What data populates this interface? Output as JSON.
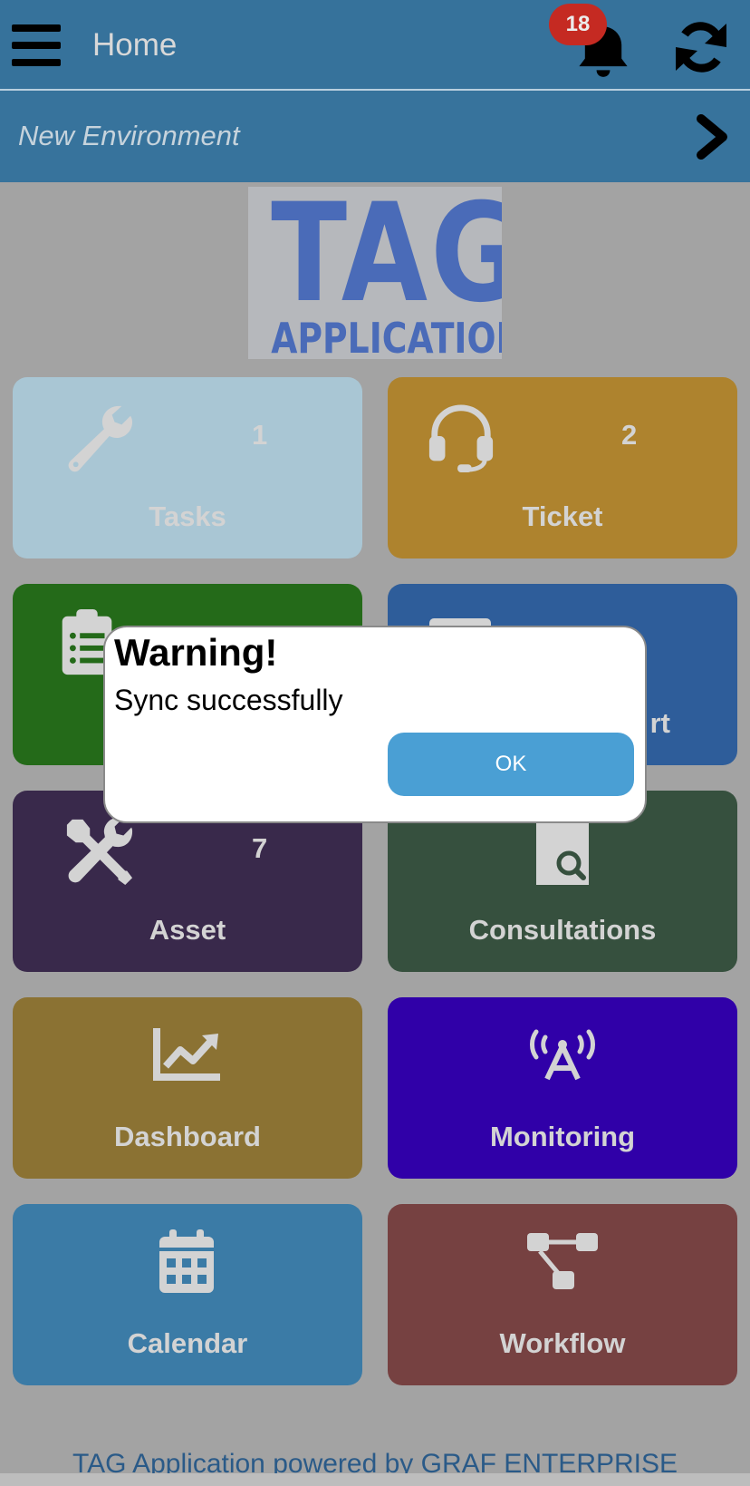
{
  "header": {
    "title": "Home",
    "notification_count": "18",
    "menu_icon": "hamburger-menu-icon",
    "bell_icon": "bell-icon",
    "sync_icon": "sync-icon"
  },
  "environment": {
    "label": "New Environment",
    "chevron_icon": "chevron-right-icon"
  },
  "logo": {
    "line1": "TAG",
    "line2": "APPLICATION"
  },
  "tiles": [
    {
      "label": "Tasks",
      "count": "1",
      "icon": "wrench-icon",
      "color": "#a9c6d4"
    },
    {
      "label": "Ticket",
      "count": "2",
      "icon": "headset-icon",
      "color": "#ae832e"
    },
    {
      "label": "",
      "count": "",
      "icon": "clipboard-list-icon",
      "color": "#246a19"
    },
    {
      "label": "rt",
      "count": "",
      "icon": "document-icon",
      "color": "#2e5d9a"
    },
    {
      "label": "Asset",
      "count": "7",
      "icon": "tools-icon",
      "color": "#39294b"
    },
    {
      "label": "Consultations",
      "count": "",
      "icon": "file-search-icon",
      "color": "#36503e"
    },
    {
      "label": "Dashboard",
      "count": "",
      "icon": "chart-line-icon",
      "color": "#8b7233"
    },
    {
      "label": "Monitoring",
      "count": "",
      "icon": "broadcast-tower-icon",
      "color": "#3000a8"
    },
    {
      "label": "Calendar",
      "count": "",
      "icon": "calendar-icon",
      "color": "#3b7ba6"
    },
    {
      "label": "Workflow",
      "count": "",
      "icon": "workflow-icon",
      "color": "#764141"
    }
  ],
  "dialog": {
    "title": "Warning!",
    "message": "Sync successfully",
    "ok_label": "OK"
  },
  "footer": {
    "text": "TAG Application powered by GRAF ENTERPRISE"
  }
}
